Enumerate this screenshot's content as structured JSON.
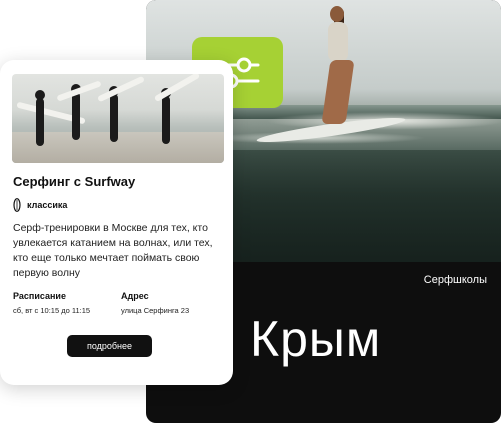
{
  "promo": {
    "subtitle": "Серфшколы",
    "city": "Крым"
  },
  "filter_button": {
    "icon": "sliders-icon",
    "color": "#a6d134"
  },
  "card": {
    "title": "Серфинг с Surfway",
    "tag": {
      "icon": "surfboard-icon",
      "label": "классика"
    },
    "description": "Серф-тренировки в Москве для тех, кто увлекается катанием на волнах, или тех, кто еще только мечтает поймать свою первую волну",
    "schedule": {
      "heading": "Расписание",
      "value": "сб, вт с 10:15 до 11:15"
    },
    "address": {
      "heading": "Адрес",
      "value": "улица Серфинга 23"
    },
    "more_button": "подробнее"
  },
  "colors": {
    "accent": "#a6d134",
    "dark": "#0e0e0e",
    "button": "#111111"
  }
}
